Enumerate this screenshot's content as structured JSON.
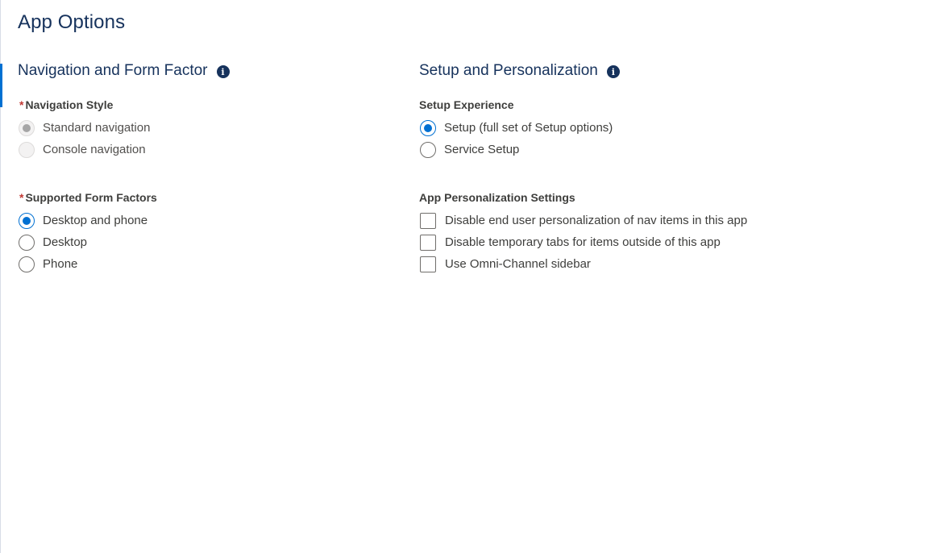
{
  "page": {
    "title": "App Options"
  },
  "left": {
    "section_title": "Navigation and Form Factor",
    "info_icon": "info-icon",
    "navigation_style": {
      "required_mark": "*",
      "label": "Navigation Style",
      "options": [
        {
          "label": "Standard navigation",
          "checked": true,
          "disabled": true
        },
        {
          "label": "Console navigation",
          "checked": false,
          "disabled": true
        }
      ]
    },
    "form_factors": {
      "required_mark": "*",
      "label": "Supported Form Factors",
      "options": [
        {
          "label": "Desktop and phone",
          "checked": true
        },
        {
          "label": "Desktop",
          "checked": false
        },
        {
          "label": "Phone",
          "checked": false
        }
      ]
    }
  },
  "right": {
    "section_title": "Setup and Personalization",
    "info_icon": "info-icon",
    "setup_experience": {
      "label": "Setup Experience",
      "options": [
        {
          "label": "Setup (full set of Setup options)",
          "checked": true
        },
        {
          "label": "Service Setup",
          "checked": false
        }
      ]
    },
    "personalization": {
      "label": "App Personalization Settings",
      "options": [
        {
          "label": "Disable end user personalization of nav items in this app",
          "checked": false
        },
        {
          "label": "Disable temporary tabs for items outside of this app",
          "checked": false
        },
        {
          "label": "Use Omni-Channel sidebar",
          "checked": false
        }
      ]
    }
  },
  "colors": {
    "accent": "#0070d2",
    "heading": "#16325c",
    "required": "#c23934",
    "text": "#3e3e3c"
  }
}
